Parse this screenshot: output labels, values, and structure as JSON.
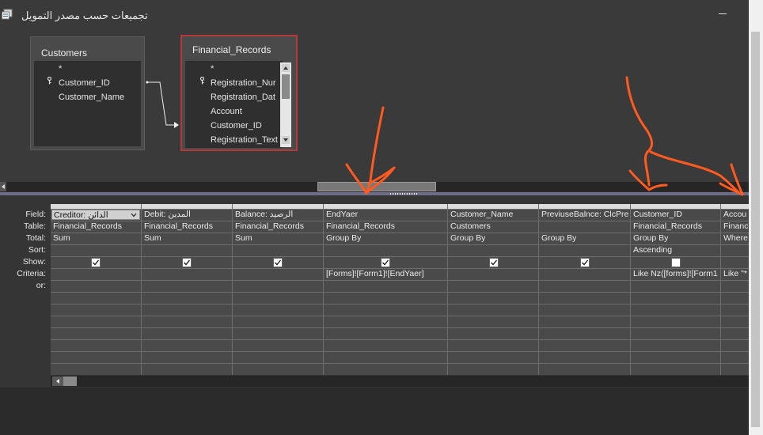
{
  "window": {
    "title": "تجميعات حسب مصدر التمويل"
  },
  "tables": {
    "customers": {
      "title": "Customers",
      "fields": [
        "*",
        "Customer_ID",
        "Customer_Name"
      ]
    },
    "financial_records": {
      "title": "Financial_Records",
      "fields": [
        "*",
        "Registration_Nur",
        "Registration_Dat",
        "Account",
        "Customer_ID",
        "Registration_Text"
      ]
    }
  },
  "row_labels": [
    "Field:",
    "Table:",
    "Total:",
    "Sort:",
    "Show:",
    "Criteria:",
    "or:"
  ],
  "columns": [
    {
      "field": "Creditor: الدائن",
      "table": "Financial_Records",
      "total": "Sum",
      "sort": "",
      "show": true,
      "criteria": ""
    },
    {
      "field": "Debit: المدين",
      "table": "Financial_Records",
      "total": "Sum",
      "sort": "",
      "show": true,
      "criteria": ""
    },
    {
      "field": "Balance: الرصيد",
      "table": "Financial_Records",
      "total": "Sum",
      "sort": "",
      "show": true,
      "criteria": ""
    },
    {
      "field": "EndYaer",
      "table": "Financial_Records",
      "total": "Group By",
      "sort": "",
      "show": true,
      "criteria": "[Forms]![Form1]![EndYaer]"
    },
    {
      "field": "Customer_Name",
      "table": "Customers",
      "total": "Group By",
      "sort": "",
      "show": true,
      "criteria": ""
    },
    {
      "field": "PreviuseBalnce: ClcPre",
      "table": "",
      "total": "Group By",
      "sort": "",
      "show": true,
      "criteria": ""
    },
    {
      "field": "Customer_ID",
      "table": "Financial_Records",
      "total": "Group By",
      "sort": "Ascending",
      "show": false,
      "criteria": "Like Nz([forms]![Form1"
    },
    {
      "field": "Accou",
      "table": "Financ",
      "total": "Where",
      "sort": "",
      "show": false,
      "criteria": "Like \"*"
    }
  ],
  "colors": {
    "annotation": "#ff5a1f",
    "selected_table_border": "#b23a3a"
  }
}
